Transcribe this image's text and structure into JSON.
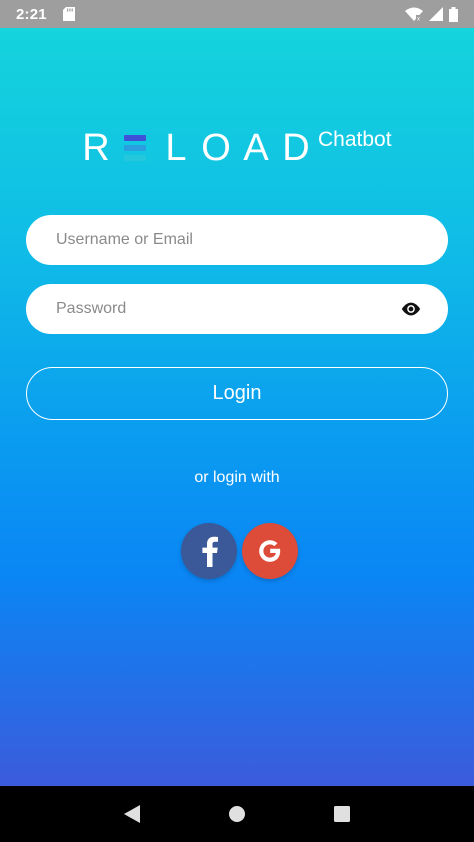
{
  "status_bar": {
    "time": "2:21"
  },
  "logo": {
    "letters": [
      "R",
      "L",
      "O",
      "A",
      "D"
    ],
    "subtitle": "Chatbot",
    "bar_colors": [
      "#3f51d6",
      "#2a9fe0",
      "#25c7dc"
    ]
  },
  "form": {
    "username_placeholder": "Username or Email",
    "password_placeholder": "Password",
    "login_label": "Login",
    "or_text": "or login with"
  },
  "social": {
    "facebook_color": "#3b5998",
    "google_color": "#dd4b39"
  },
  "colors": {
    "gradient_top": "#14d4dc",
    "gradient_bottom": "#3b5bdb"
  }
}
